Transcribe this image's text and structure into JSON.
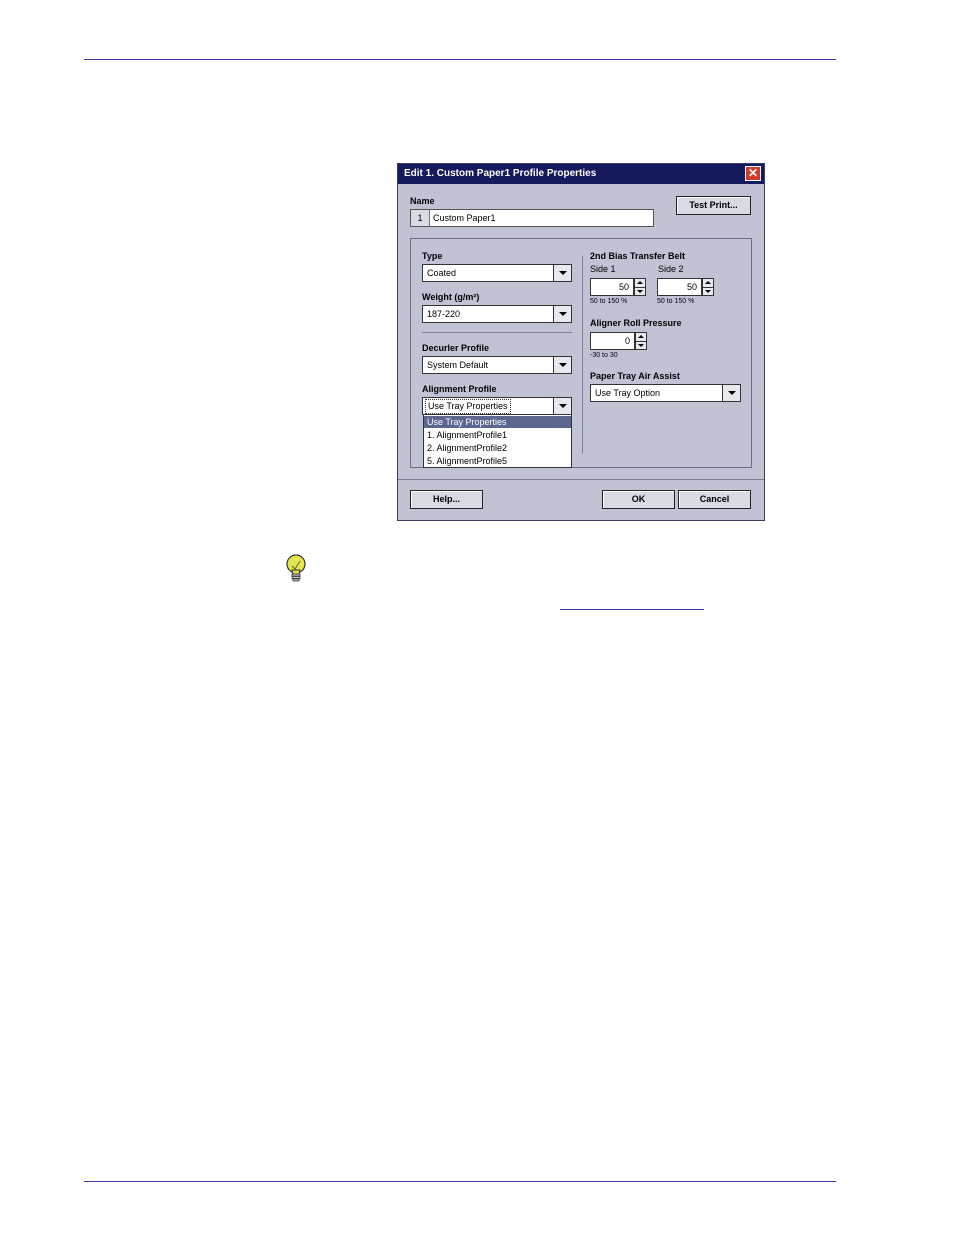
{
  "dialog": {
    "title": "Edit 1. Custom Paper1 Profile Properties",
    "close_label": "✕",
    "name_label": "Name",
    "name_number": "1",
    "name_value": "Custom Paper1",
    "test_print_label": "Test Print...",
    "type": {
      "label": "Type",
      "value": "Coated"
    },
    "weight": {
      "label": "Weight (g/m²)",
      "value": "187-220"
    },
    "decurler": {
      "label": "Decurler Profile",
      "value": "System Default"
    },
    "alignment": {
      "label": "Alignment Profile",
      "value": "Use Tray Properties",
      "options": [
        "Use Tray Properties",
        "1. AlignmentProfile1",
        "2. AlignmentProfile2",
        "5. AlignmentProfile5"
      ]
    },
    "bias": {
      "label": "2nd Bias Transfer Belt",
      "side1_label": "Side 1",
      "side1_value": "50",
      "side1_range": "50 to 150 %",
      "side2_label": "Side 2",
      "side2_value": "50",
      "side2_range": "50 to 150 %"
    },
    "aligner": {
      "label": "Aligner Roll Pressure",
      "value": "0",
      "range": "-30 to 30"
    },
    "air_assist": {
      "label": "Paper Tray Air Assist",
      "value": "Use Tray Option"
    },
    "help_label": "Help...",
    "ok_label": "OK",
    "cancel_label": "Cancel"
  },
  "colors": {
    "rule": "#3a3aa0",
    "titlebar": "#151a5c",
    "dialog_bg": "#bfc3d4",
    "selected": "#5c6790"
  },
  "icons": {
    "tip": "lightbulb-icon"
  }
}
